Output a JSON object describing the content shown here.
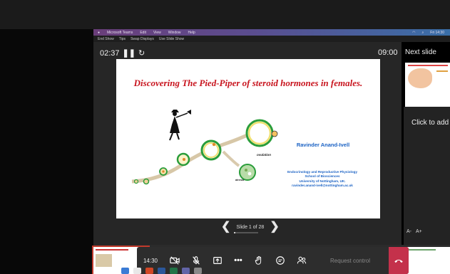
{
  "mac_menubar": {
    "items": [
      "Microsoft Teams",
      "Edit",
      "View",
      "Window",
      "Help"
    ],
    "right_time": "Fri 14:30"
  },
  "ppt_toolbar": {
    "items": [
      "End Show",
      "Tips",
      "Swap Displays",
      "Use Slide Show"
    ]
  },
  "presenter": {
    "elapsed": "02:37",
    "clock": "09:00",
    "next_slide_label": "Next slide",
    "next_notes": "Click to add",
    "font_smaller": "A-",
    "font_larger": "A+",
    "slide_counter": "Slide 1 of 28",
    "slide_progress": 0.0357
  },
  "slide": {
    "title": "Discovering The Pied-Piper of steroid hormones in females.",
    "author": "Ravinder Anand-Ivell",
    "affiliation": [
      "Endocrinology and Reproductive Physiology",
      "School of Biosciences",
      "University of Nottingham, UK.",
      "ravinder.anand-ivell@nottingham.ac.uk"
    ],
    "diagram_labels": {
      "ovulation": "ovulation",
      "atresia": "atresia"
    }
  },
  "call_controls": {
    "duration": "14:30",
    "request_control": "Request control",
    "icons": [
      "camera-off-icon",
      "mic-off-icon",
      "share-icon",
      "more-icon",
      "raise-hand-icon",
      "chat-icon",
      "participants-icon",
      "hangup-icon"
    ]
  },
  "colors": {
    "accent_red": "#c4314b",
    "title_red": "#c8141e",
    "author_blue": "#1b62c4"
  }
}
